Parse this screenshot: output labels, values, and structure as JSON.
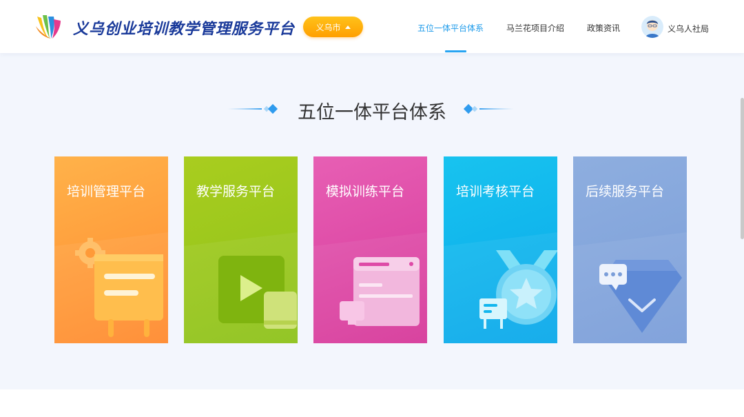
{
  "header": {
    "site_title": "义乌创业培训教学管理服务平台",
    "city_button": "义乌市",
    "nav": [
      {
        "label": "五位一体平台体系",
        "active": true
      },
      {
        "label": "马兰花项目介绍",
        "active": false
      },
      {
        "label": "政策资讯",
        "active": false
      }
    ],
    "user_name": "义乌人社局"
  },
  "section": {
    "title": "五位一体平台体系"
  },
  "cards": [
    {
      "label": "培训管理平台",
      "icon": "easel-gear-icon",
      "color": "#ff9a38"
    },
    {
      "label": "教学服务平台",
      "icon": "video-play-icon",
      "color": "#9ac81d"
    },
    {
      "label": "模拟训练平台",
      "icon": "browser-window-icon",
      "color": "#de4aa7"
    },
    {
      "label": "培训考核平台",
      "icon": "medal-star-icon",
      "color": "#12b6ee"
    },
    {
      "label": "后续服务平台",
      "icon": "chat-diamond-icon",
      "color": "#84a5db"
    }
  ],
  "colors": {
    "accent": "#1e9bea",
    "city_button": "#ffb00e",
    "page_bg": "#f3f6fd"
  }
}
